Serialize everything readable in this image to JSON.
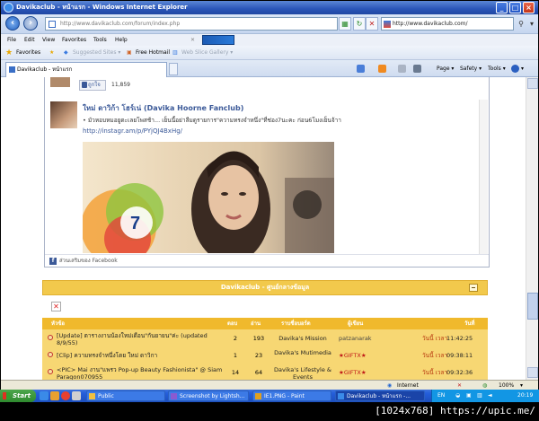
{
  "window": {
    "title": "Davikaclub - หน้าแรก - Windows Internet Explorer"
  },
  "address_bar": {
    "url": "http://www.davikaclub.com/forum/index.php",
    "search_url": "http://www.davikaclub.com/"
  },
  "menu": [
    "File",
    "Edit",
    "View",
    "Favorites",
    "Tools",
    "Help"
  ],
  "favorites_bar": {
    "favorites_label": "Favorites",
    "suggested_sites": "Suggested Sites ▾",
    "free_hotmail": "Free Hotmail",
    "web_slice_gallery": "Web Slice Gallery ▾"
  },
  "tab": {
    "label": "Davikaclub - หน้าแรก"
  },
  "command_bar": {
    "page": "Page ▾",
    "safety": "Safety ▾",
    "tools": "Tools ▾",
    "help": "▾"
  },
  "facebook_box": {
    "like_label": "ถูกใจ",
    "like_count": "11,859",
    "post_name": "ใหม่ ดาวิก้า โฮร์เน่ (Davika Hoorne Fanclub)",
    "post_text": "• มัวหอบหมอยูดะเลยโพสช้า... เย็นนี้อย่าลืมดูรายการ\"ความทรงจำหนึ่ง\"ที่ช่อง7นะคะ ก่อน6โมงเย็นจ้าา",
    "post_link": "http://instagr.am/p/PYjQJ4BxHg/",
    "footer": "ส่วนเสริมของ Facebook"
  },
  "forum": {
    "header_title": "Davikaclub - ศูนย์กลางข้อมูล",
    "columns": {
      "topic": "หัวข้อ",
      "replies": "ตอบ",
      "views": "อ่าน",
      "forum": "ราบชื่อบอร์ด",
      "author": "ผู้เขียน",
      "date": "วันที่"
    },
    "rows": [
      {
        "title": "[Update] ตารางงานน้องใหม่เดือน\"กันยายน\"ค่ะ (updated 8/9/55)",
        "replies": "2",
        "views": "193",
        "forum": "Davika's Mission",
        "author": "patzanarak",
        "author_highlight": false,
        "date": "วันนี้ เวลา",
        "time": "11:42:25"
      },
      {
        "title": "[Clip] ความทรงจำหนึ่งโดย ใหม่ ดาวิกา",
        "replies": "1",
        "views": "23",
        "forum": "Davika's Mutimedia",
        "author": "★GIFTX★",
        "author_highlight": true,
        "date": "วันนี้ เวลา",
        "time": "09:38:11"
      },
      {
        "title": "<PIC> Mai งาน\"แพรว Pop-up Beauty Fashionista\" @ Siam Paragon070955",
        "replies": "14",
        "views": "64",
        "forum": "Davika's Lifestyle & Events",
        "author": "★GIFTX★",
        "author_highlight": true,
        "date": "วันนี้ เวลา",
        "time": "09:32:36"
      }
    ]
  },
  "status_bar": {
    "zone": "Internet",
    "zoom": "100%"
  },
  "taskbar": {
    "start": "Start",
    "tasks": [
      "Public",
      "Screenshot by Lightsh...",
      "IE1.PNG - Paint",
      "Davikaclub - หน้าแรก -..."
    ],
    "lang": "EN",
    "clock": "20:19"
  },
  "watermark": "[1024x768] https://upic.me/"
}
